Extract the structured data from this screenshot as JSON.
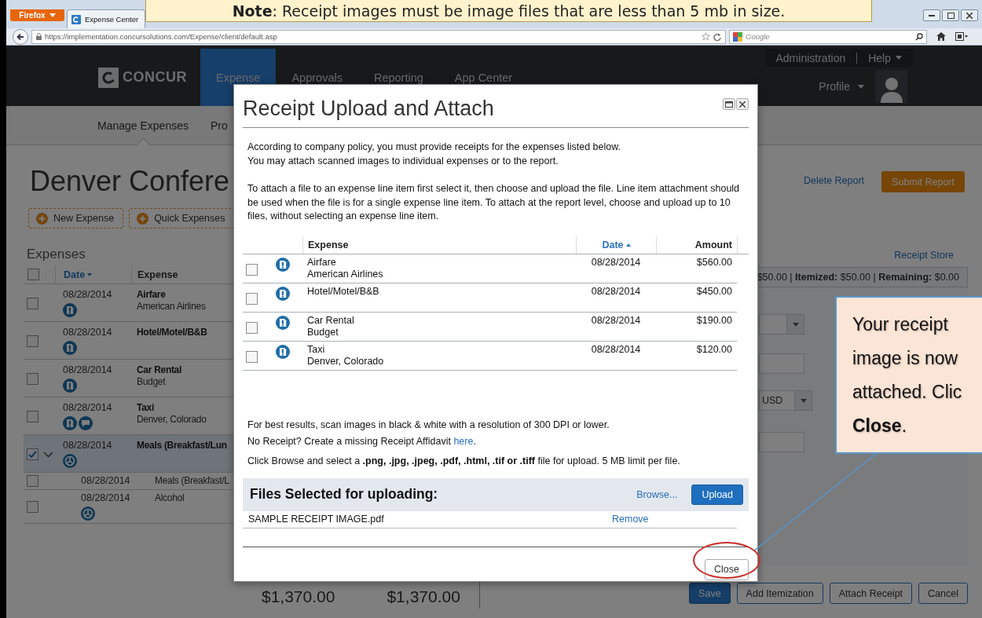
{
  "note": "**Note**: Receipt images must be image files that are less than 5 mb in size.",
  "browser": {
    "menu_button": "Firefox",
    "tabs": [
      {
        "title": "Expense Center",
        "selected": true
      }
    ],
    "url": "https://implementation.concursolutions.com/Expense/client/default.asp",
    "search": {
      "placeholder": "Google"
    }
  },
  "header": {
    "logo": "CONCUR",
    "nav": [
      {
        "label": "Expense",
        "selected": true
      },
      {
        "label": "Approvals",
        "selected": false
      },
      {
        "label": "Reporting",
        "selected": false
      },
      {
        "label": "App Center",
        "selected": false
      }
    ],
    "utility_links": [
      {
        "label": "Administration",
        "dropdown": false
      },
      {
        "label": "Help",
        "dropdown": true
      }
    ],
    "profile": {
      "label": "Profile"
    }
  },
  "subnav": [
    {
      "label": "Manage Expenses",
      "selected": true
    },
    {
      "label": "Pro",
      "selected": false
    }
  ],
  "report": {
    "title": "Denver Confere",
    "actions": [
      {
        "label": "New Expense"
      },
      {
        "label": "Quick Expenses"
      }
    ],
    "delete_link": "Delete Report",
    "submit_button": "Submit Report"
  },
  "expenses": {
    "heading": "Expenses",
    "select_all": {
      "checked": false
    },
    "columns": [
      {
        "label": "Date",
        "sorted": true,
        "descending": true
      },
      {
        "label": "Expense",
        "sorted": false
      }
    ],
    "rows": [
      {
        "date": "08/28/2014",
        "title": "Airfare",
        "detail": "American Airlines",
        "icons": [
          {
            "kind": "alert"
          }
        ],
        "checked": false,
        "selected": false
      },
      {
        "date": "08/28/2014",
        "title": "Hotel/Motel/B&B",
        "icons": [
          {
            "kind": "alert"
          }
        ],
        "checked": false,
        "selected": false
      },
      {
        "date": "08/28/2014",
        "title": "Car Rental",
        "detail": "Budget",
        "icons": [
          {
            "kind": "alert"
          }
        ],
        "checked": false,
        "selected": false
      },
      {
        "date": "08/28/2014",
        "title": "Taxi",
        "detail": "Denver, Colorado",
        "icons": [
          {
            "kind": "alert"
          },
          {
            "kind": "comment"
          }
        ],
        "checked": false,
        "selected": false
      },
      {
        "date": "08/28/2014",
        "title": "Meals (Breakfast/Lun",
        "icons": [
          {
            "kind": "itemized"
          }
        ],
        "checked": true,
        "selected": true,
        "expanded": true,
        "children": [
          {
            "date": "08/28/2014",
            "title": "Meals (Breakfast/L",
            "checked": false
          },
          {
            "date": "08/28/2014",
            "title": "Alcohol",
            "icons": [
              {
                "kind": "itemized"
              }
            ],
            "checked": false
          }
        ]
      }
    ]
  },
  "detail_pane": {
    "receipt_store_link": "Receipt Store",
    "summary": "$50.00 | **Itemized:** $50.00 | **Remaining:** $0.00",
    "fields": [
      {
        "kind": "select"
      },
      {
        "kind": "input"
      },
      {
        "kind": "select",
        "value": "USD"
      },
      {
        "kind": "input"
      }
    ]
  },
  "totals": [
    {
      "value": "$1,370.00"
    },
    {
      "value": "$1,370.00"
    }
  ],
  "footer_buttons": [
    {
      "label": "Save",
      "primary": true
    },
    {
      "label": "Add Itemization",
      "primary": false
    },
    {
      "label": "Attach Receipt",
      "primary": false
    },
    {
      "label": "Cancel",
      "primary": false
    }
  ],
  "modal": {
    "title": "Receipt Upload and Attach",
    "intro": [
      "According to company policy, you must provide receipts for the expenses listed below.",
      "You may attach scanned images to individual expenses or to the report.",
      "To attach a file to an expense line item first select it, then choose and upload the file. Line item attachment should be used when the file is for a single expense line item. To attach at the report level, choose and upload up to 10 files, without selecting an expense line item."
    ],
    "table": {
      "columns": [
        {
          "label": "Expense",
          "sorted": false
        },
        {
          "label": "Date",
          "sorted": true,
          "descending": false
        },
        {
          "label": "Amount",
          "sorted": false
        }
      ],
      "rows": [
        {
          "title": "Airfare",
          "detail": "American Airlines",
          "date": "08/28/2014",
          "amount": "$560.00",
          "checked": false
        },
        {
          "title": "Hotel/Motel/B&B",
          "date": "08/28/2014",
          "amount": "$450.00",
          "checked": false
        },
        {
          "title": "Car Rental",
          "detail": "Budget",
          "date": "08/28/2014",
          "amount": "$190.00",
          "checked": false
        },
        {
          "title": "Taxi",
          "detail": "Denver, Colorado",
          "date": "08/28/2014",
          "amount": "$120.00",
          "checked": false
        }
      ]
    },
    "tips": [
      {
        "text": "For best results, scan images in black & white with a resolution of 300 DPI or lower."
      },
      {
        "text": "No Receipt? Create a missing Receipt Affidavit ",
        "link": "here",
        "after": "."
      },
      {
        "text": "Click Browse and select a **.png, .jpg, .jpeg, .pdf, .html, .tif or .tiff** file for upload. 5 MB limit per file."
      }
    ],
    "files": {
      "heading": "Files Selected for uploading:",
      "browse_link": "Browse...",
      "upload_button": "Upload",
      "items": [
        {
          "name": "SAMPLE RECEIPT IMAGE.pdf",
          "action": "Remove"
        }
      ]
    },
    "close_button": "Close"
  },
  "callout": {
    "text": "Your receipt image is now attached. Clic **Close**."
  }
}
